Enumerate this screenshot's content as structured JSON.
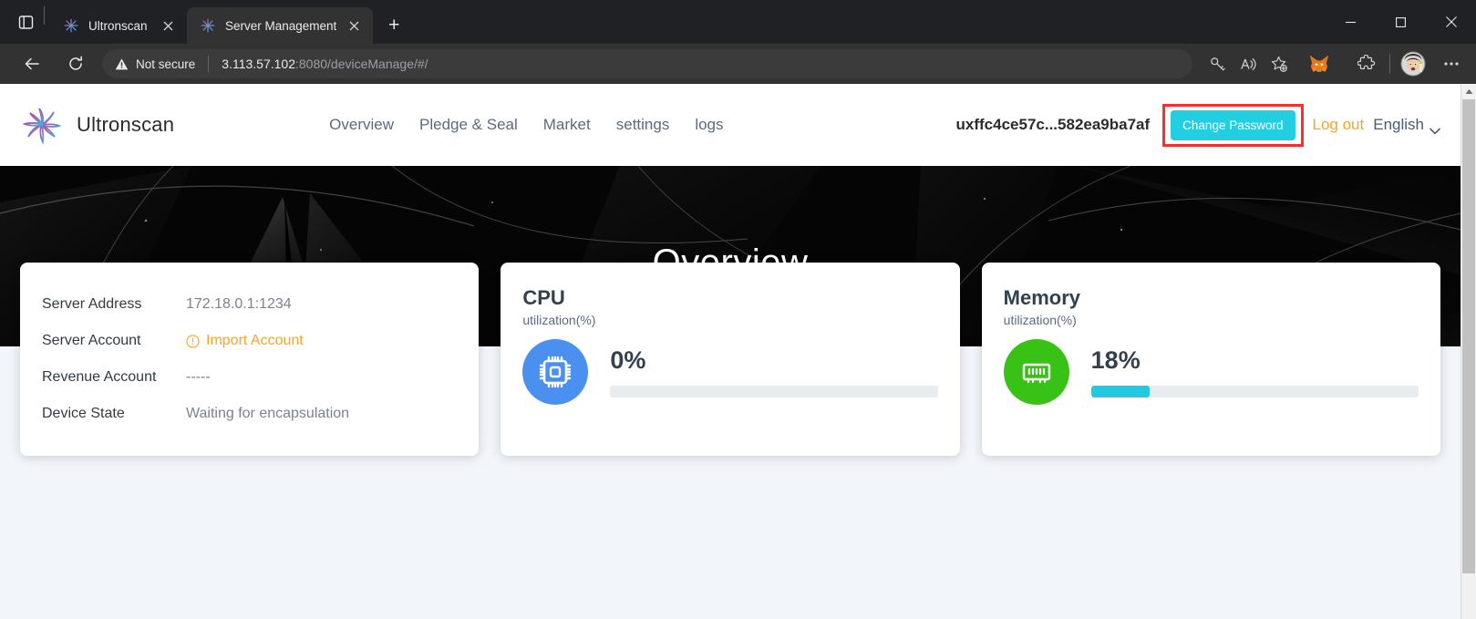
{
  "browser": {
    "tab_search_icon": "tab-list-icon",
    "tabs": [
      {
        "title": "Ultronscan",
        "favicon": "ultronscan-logo-icon",
        "active": false
      },
      {
        "title": "Server Management",
        "favicon": "ultronscan-logo-icon",
        "active": true
      }
    ],
    "new_tab_label": "+",
    "window_controls": {
      "minimize": "–",
      "maximize": "☐",
      "close": "✕"
    },
    "toolbar": {
      "back_icon": "back-arrow-icon",
      "reload_icon": "reload-icon",
      "security_label": "Not secure",
      "url_host": "3.113.57.102",
      "url_path": ":8080/deviceManage/#/",
      "right_icons": [
        "password-key-icon",
        "read-aloud-icon",
        "add-favorite-icon",
        "metamask-fox-icon",
        "extensions-icon",
        "profile-avatar-icon",
        "settings-more-icon"
      ]
    }
  },
  "app": {
    "brand": {
      "name": "Ultronscan",
      "logo_icon": "ultronscan-pinwheel-icon"
    },
    "nav": [
      {
        "label": "Overview"
      },
      {
        "label": "Pledge & Seal"
      },
      {
        "label": "Market"
      },
      {
        "label": "settings"
      },
      {
        "label": "logs"
      }
    ],
    "wallet_address": "uxffc4ce57c...582ea9ba7af",
    "change_password_label": "Change Password",
    "logout_label": "Log out",
    "language_label": "English",
    "language_chevron_icon": "chevron-down-icon",
    "highlight_color": "#fc2d2d",
    "accent_color": "#22cfe0",
    "logout_color": "#f5a623"
  },
  "hero": {
    "title": "Overview"
  },
  "cards": {
    "server_info": {
      "rows": [
        {
          "label": "Server Address",
          "value": "172.18.0.1:1234",
          "type": "text"
        },
        {
          "label": "Server Account",
          "value": "Import Account",
          "type": "warn",
          "icon": "exclamation-circle-icon"
        },
        {
          "label": "Revenue Account",
          "value": "-----",
          "type": "text"
        },
        {
          "label": "Device State",
          "value": "Waiting for encapsulation",
          "type": "text"
        }
      ]
    },
    "cpu": {
      "title": "CPU",
      "subtitle": "utilization(%)",
      "percent_label": "0%",
      "percent_value": 0,
      "icon": "cpu-chip-icon",
      "icon_bg": "#4a90f0",
      "bar_color": "#22c9e0"
    },
    "memory": {
      "title": "Memory",
      "subtitle": "utilization(%)",
      "percent_label": "18%",
      "percent_value": 18,
      "icon": "memory-ram-icon",
      "icon_bg": "#39c216",
      "bar_color": "#22c9e0"
    }
  },
  "scrollbar": {
    "up_arrow_icon": "scroll-up-arrow-icon"
  }
}
